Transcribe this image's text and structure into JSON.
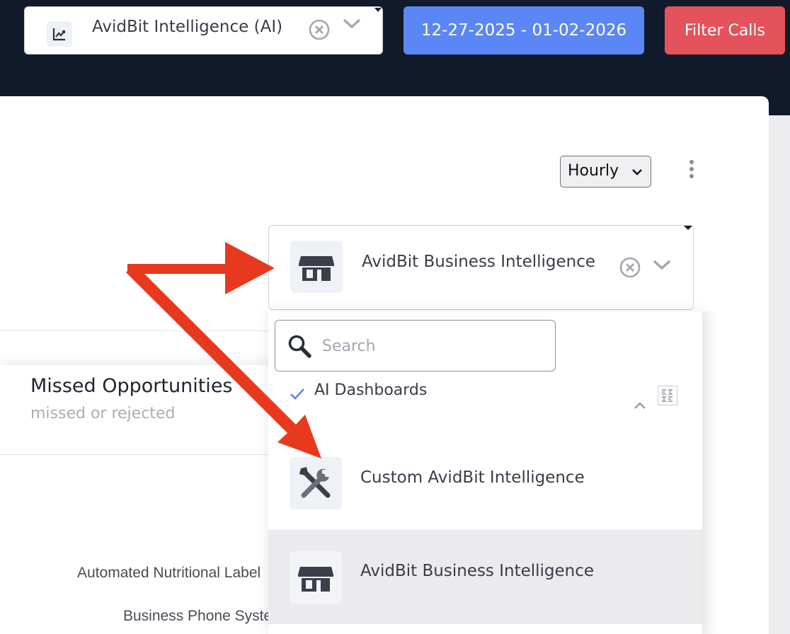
{
  "header": {
    "integration_select": {
      "label": "AvidBit Intelligence (AI)",
      "icon": "chart-line-icon"
    },
    "date_range_label": "12-27-2025 - 01-02-2026",
    "filter_calls_label": "Filter Calls"
  },
  "panel": {
    "interval_select": {
      "value": "Hourly"
    },
    "dashboard_select": {
      "value": "AvidBit Business Intelligence",
      "icon": "storefront-icon"
    }
  },
  "card": {
    "title": "Missed Opportunities",
    "subtitle": "missed or rejected",
    "rows": [
      "Automated Nutritional Label",
      "Business Phone Syste"
    ]
  },
  "dropdown": {
    "search_placeholder": "Search",
    "group": {
      "label": "AI Dashboards",
      "checked": true
    },
    "options": [
      {
        "label": "Custom AvidBit Intelligence",
        "icon": "tools-icon"
      },
      {
        "label": "AvidBit Business Intelligence",
        "icon": "storefront-icon",
        "highlighted": true
      }
    ]
  },
  "colors": {
    "topbar": "#111a2a",
    "date_button": "#5b86f5",
    "filter_button": "#e4525b",
    "annotation_arrow": "#e8391e"
  }
}
